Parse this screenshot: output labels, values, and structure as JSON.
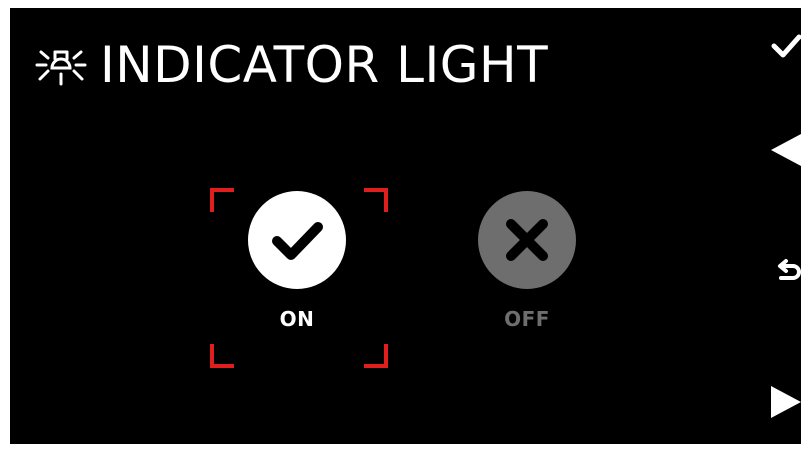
{
  "screen": {
    "title": "INDICATOR LIGHT",
    "title_icon": "light-bulb-icon"
  },
  "options": [
    {
      "label": "ON",
      "icon": "check-icon",
      "selected": true,
      "color": "#ffffff"
    },
    {
      "label": "OFF",
      "icon": "x-icon",
      "selected": false,
      "color": "#6e6e6e"
    }
  ],
  "selection_color": "#e01e1e",
  "side_buttons": [
    {
      "icon": "checkmark-icon",
      "action": "confirm"
    },
    {
      "icon": "left-arrow-icon",
      "action": "previous"
    },
    {
      "icon": "back-icon",
      "action": "back"
    },
    {
      "icon": "right-arrow-icon",
      "action": "next"
    }
  ]
}
